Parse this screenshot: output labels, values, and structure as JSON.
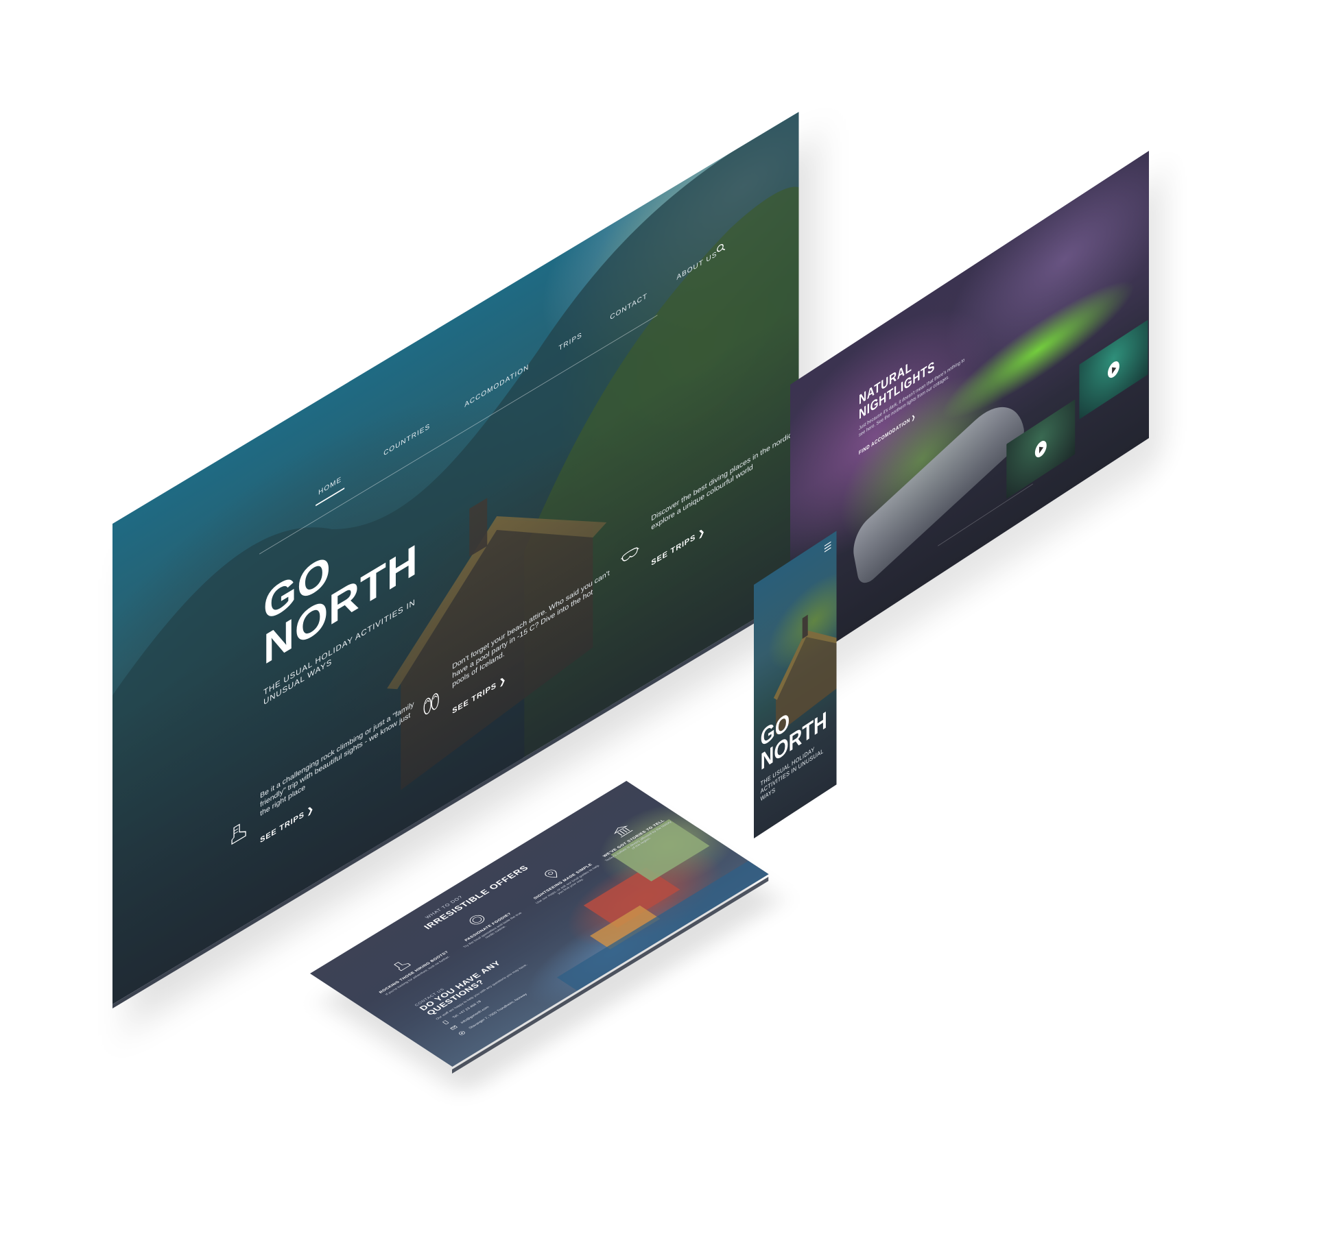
{
  "nav": {
    "items": [
      "HOME",
      "COUNTRIES",
      "ACCOMODATION",
      "TRIPS",
      "CONTACT",
      "ABOUT US"
    ],
    "active": "HOME"
  },
  "hero": {
    "title": "GO NORTH",
    "subtitle": "THE USUAL HOLIDAY ACTIVITIES IN UNUSUAL WAYS"
  },
  "features": [
    {
      "icon": "hiking-boot-icon",
      "text": "Be it a challenging rock climbing or just a \"family friendly\" trip with beautiful sights - we know just the right place",
      "link": "SEE TRIPS"
    },
    {
      "icon": "flip-flops-icon",
      "text": "Don't forget your beach attire. Who said you can't have a pool party in -15 C? Dive into the hot pools of Iceland.",
      "link": "SEE TRIPS"
    },
    {
      "icon": "diving-mask-icon",
      "text": "Discover the best diving places in the nordic and explore a unique colourful world",
      "link": "SEE TRIPS"
    }
  ],
  "aurora": {
    "title": "NATURAL NIGHTLIGHTS",
    "text": "Just because it's dark, it doesn't mean that there's nothing to see here. See the northern lights from our cottages.",
    "link": "FIND ACCOMODATION"
  },
  "mobile": {
    "title": "GO NORTH",
    "subtitle": "THE USUAL HOLIDAY ACTIVITIES IN UNUSUAL WAYS"
  },
  "offers": {
    "kicker": "WHAT TO DO?",
    "title": "IRRESISTIBLE OFFERS",
    "items": [
      {
        "icon": "hiking-boot-icon",
        "title": "ROCKING THOSE HIKING BOOTS?",
        "desc": "If you're looking for adventure, look no further."
      },
      {
        "icon": "plate-icon",
        "title": "PASSIONATE FOODIE?",
        "desc": "Try the local specialties and taste the true nordic cuisine."
      },
      {
        "icon": "map-pin-icon",
        "title": "SIGHTSEEING MADE SIMPLE",
        "desc": "Use our maps, or ask our local guides to help you find your way."
      },
      {
        "icon": "museum-icon",
        "title": "WE'VE GOT STORIES TO TELL",
        "desc": "Today's culture is deeply affected by the history of the region."
      }
    ]
  },
  "contact": {
    "kicker": "CONTACT US",
    "title": "DO YOU HAVE ANY QUESTIONS?",
    "desc": "Our staff are happy to help you with any questions you may have.",
    "phone": "Tel: +47 23 456 78",
    "email": "info@gonorth.com",
    "address": "Stavanger 7, 7000 Trondheim, Norway"
  },
  "colors": {
    "accent": "#ffffff",
    "night": "#2a3038",
    "aurora_green": "#76d63c"
  }
}
